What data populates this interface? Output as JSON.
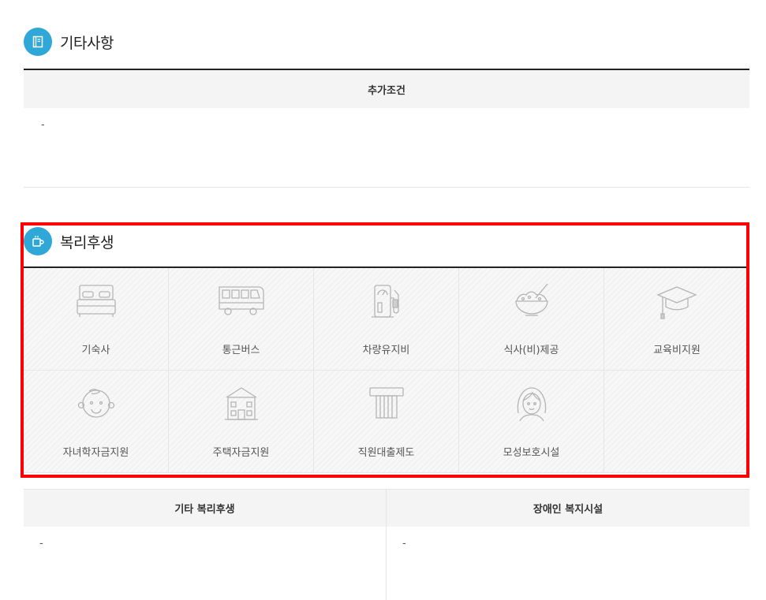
{
  "etc": {
    "title": "기타사항",
    "icon": "document-icon",
    "table_header": "추가조건",
    "table_value": "-"
  },
  "welfare": {
    "title": "복리후생",
    "icon": "coffee-cup-icon",
    "items": [
      {
        "label": "기숙사",
        "icon": "bed-icon"
      },
      {
        "label": "통근버스",
        "icon": "bus-icon"
      },
      {
        "label": "차량유지비",
        "icon": "fuel-pump-icon"
      },
      {
        "label": "식사(비)제공",
        "icon": "rice-bowl-icon"
      },
      {
        "label": "교육비지원",
        "icon": "graduation-cap-icon"
      },
      {
        "label": "자녀학자금지원",
        "icon": "child-face-icon"
      },
      {
        "label": "주택자금지원",
        "icon": "house-icon"
      },
      {
        "label": "직원대출제도",
        "icon": "atm-cash-icon"
      },
      {
        "label": "모성보호시설",
        "icon": "woman-face-icon"
      }
    ]
  },
  "bottom": {
    "left_header": "기타 복리후생",
    "left_value": "-",
    "right_header": "장애인 복지시설",
    "right_value": "-"
  },
  "colors": {
    "accent": "#2fa8d8",
    "highlight": "#ff0000",
    "header_bg": "#f4f4f4"
  }
}
